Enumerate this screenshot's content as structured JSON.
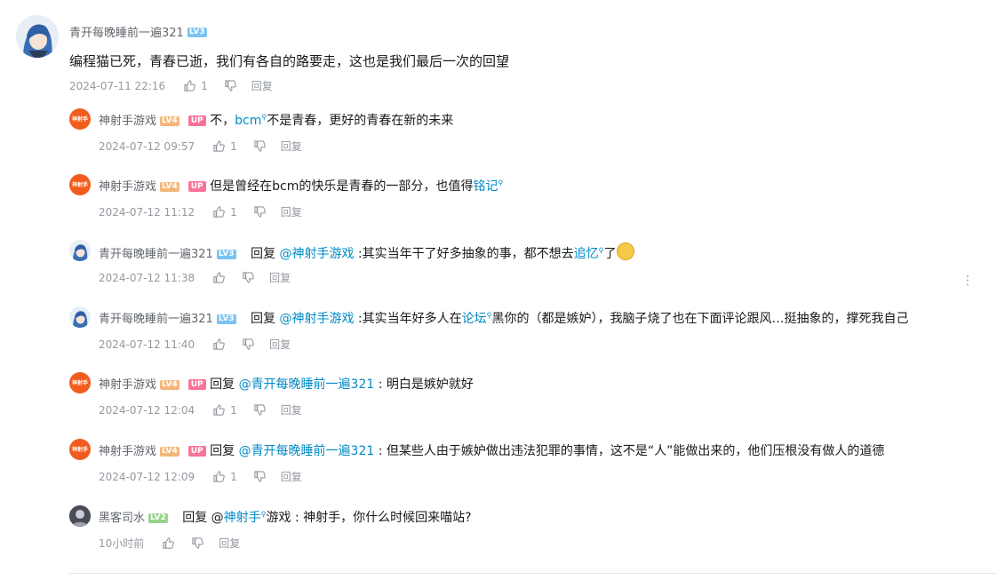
{
  "main": {
    "username": "青开每晚睡前一遍321",
    "level": "LV3",
    "text": "编程猫已死，青春已逝，我们有各自的路要走，这也是我们最后一次的回望",
    "time": "2024-07-11 22:16",
    "likes": "1",
    "reply_label": "回复"
  },
  "replies": [
    {
      "username": "神射手游戏",
      "level": "LV4",
      "up_tag": "UP",
      "pre": "不，",
      "jump": "bcm",
      "post": "不是青春，更好的青春在新的未来",
      "time": "2024-07-12 09:57",
      "likes": "1",
      "reply_label": "回复"
    },
    {
      "username": "神射手游戏",
      "level": "LV4",
      "up_tag": "UP",
      "pre": "但是曾经在bcm的快乐是青春的一部分，也值得",
      "jump": "铭记",
      "time": "2024-07-12 11:12",
      "likes": "1",
      "reply_label": "回复"
    },
    {
      "username": "青开每晚睡前一遍321",
      "level": "LV3",
      "reply_word": "回复",
      "mention": "@神射手游戏",
      "pre": " :其实当年干了好多抽象的事，都不想去",
      "jump": "追忆",
      "post": "了",
      "emoji": "laughing-crying-emoji",
      "time": "2024-07-12 11:38",
      "reply_label": "回复"
    },
    {
      "username": "青开每晚睡前一遍321",
      "level": "LV3",
      "reply_word": "回复",
      "mention": "@神射手游戏",
      "pre": " :其实当年好多人在",
      "jump": "论坛",
      "post": "黑你的（都是嫉妒），我脑子烧了也在下面评论跟风…挺抽象的，撑死我自己",
      "time": "2024-07-12 11:40",
      "reply_label": "回复"
    },
    {
      "username": "神射手游戏",
      "level": "LV4",
      "up_tag": "UP",
      "reply_word": "回复",
      "mention": "@青开每晚睡前一遍321",
      "pre": " : 明白是嫉妒就好",
      "time": "2024-07-12 12:04",
      "likes": "1",
      "reply_label": "回复"
    },
    {
      "username": "神射手游戏",
      "level": "LV4",
      "up_tag": "UP",
      "reply_word": "回复",
      "mention": "@青开每晚睡前一遍321",
      "pre": " : 但某些人由于嫉妒做出违法犯罪的事情，这不是“人”能做出来的，他们压根没有做人的道德",
      "time": "2024-07-12 12:09",
      "likes": "1",
      "reply_label": "回复"
    },
    {
      "username": "黑客司水",
      "level": "LV2",
      "reply_word": "回复",
      "mention_plain": "@",
      "jump": "神射手",
      "post": "游戏 : 神射手，你什么时候回来喵站?",
      "time": "10小时前",
      "reply_label": "回复"
    }
  ],
  "orange_avatar_text": "神射手",
  "colors": {
    "link": "#008ac5",
    "up_tag": "#fb7299",
    "meta": "#9499a0"
  }
}
